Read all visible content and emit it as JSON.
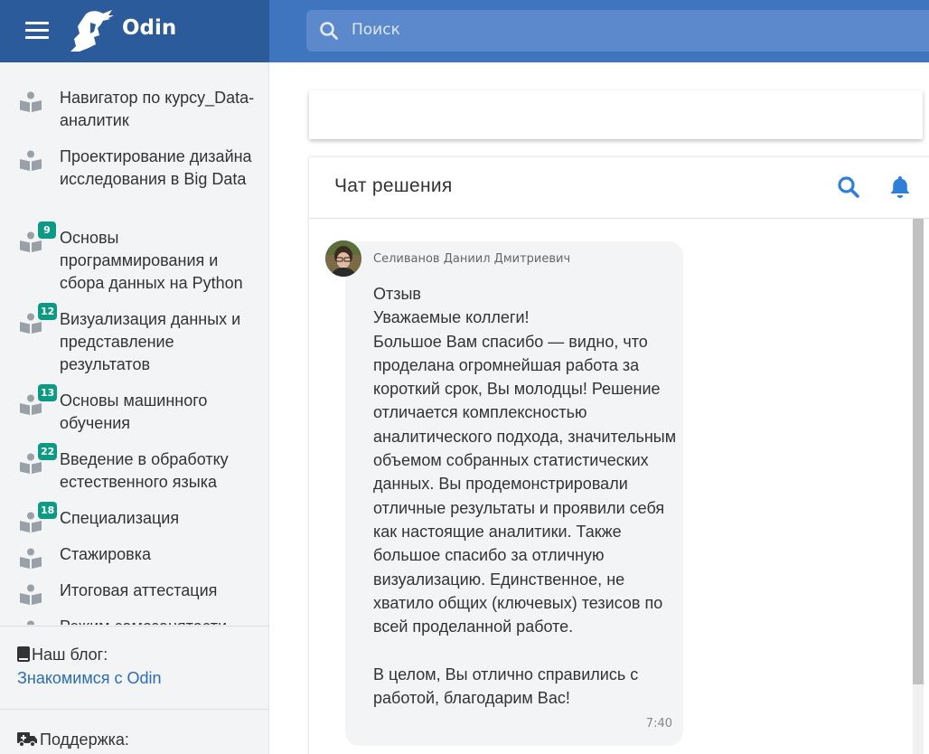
{
  "app": {
    "brand": "Odin"
  },
  "search": {
    "placeholder": "Поиск"
  },
  "sidebar": {
    "items": [
      {
        "label": "Навигатор по курсу_Data-аналитик",
        "badge": ""
      },
      {
        "label": "Проектирование дизайна исследования в Big Data",
        "badge": ""
      },
      {
        "label": "Основы программирования и сбора данных на Python",
        "badge": "9"
      },
      {
        "label": "Визуализация данных и представление результатов",
        "badge": "12"
      },
      {
        "label": "Основы машинного обучения",
        "badge": "13"
      },
      {
        "label": "Введение в обработку естественного языка",
        "badge": "22"
      },
      {
        "label": "Специализация",
        "badge": "18"
      },
      {
        "label": "Стажировка",
        "badge": ""
      },
      {
        "label": "Итоговая аттестация",
        "badge": ""
      },
      {
        "label": "Режим самозанятости",
        "badge": ""
      }
    ],
    "blog_label": "Наш блог:",
    "blog_link": "Знакомимся с Odin",
    "support_label": "Поддержка:"
  },
  "chat": {
    "title": "Чат решения",
    "message": {
      "sender": "Селиванов Даниил Дмитриевич",
      "text": "Отзыв\nУважаемые коллеги!\nБольшое Вам спасибо — видно, что проделана огромнейшая работа за короткий срок, Вы молодцы! Решение отличается комплексностью аналитического подхода, значительным объемом собранных статистических данных. Вы продемонстрировали отличные результаты и проявили себя как настоящие аналитики. Также большое спасибо за отличную визуализацию. Единственное, не хватило общих (ключевых) тезисов по всей проделанной работе.\n\nВ целом, Вы отлично справились с работой, благодарим Вас!",
      "time": "7:40"
    }
  },
  "colors": {
    "topbar_left": "#2c5b9c",
    "topbar_right": "#3f74bf",
    "badge": "#0c9a84",
    "link": "#2d6cb5",
    "accent_icon": "#2f7fd8"
  }
}
